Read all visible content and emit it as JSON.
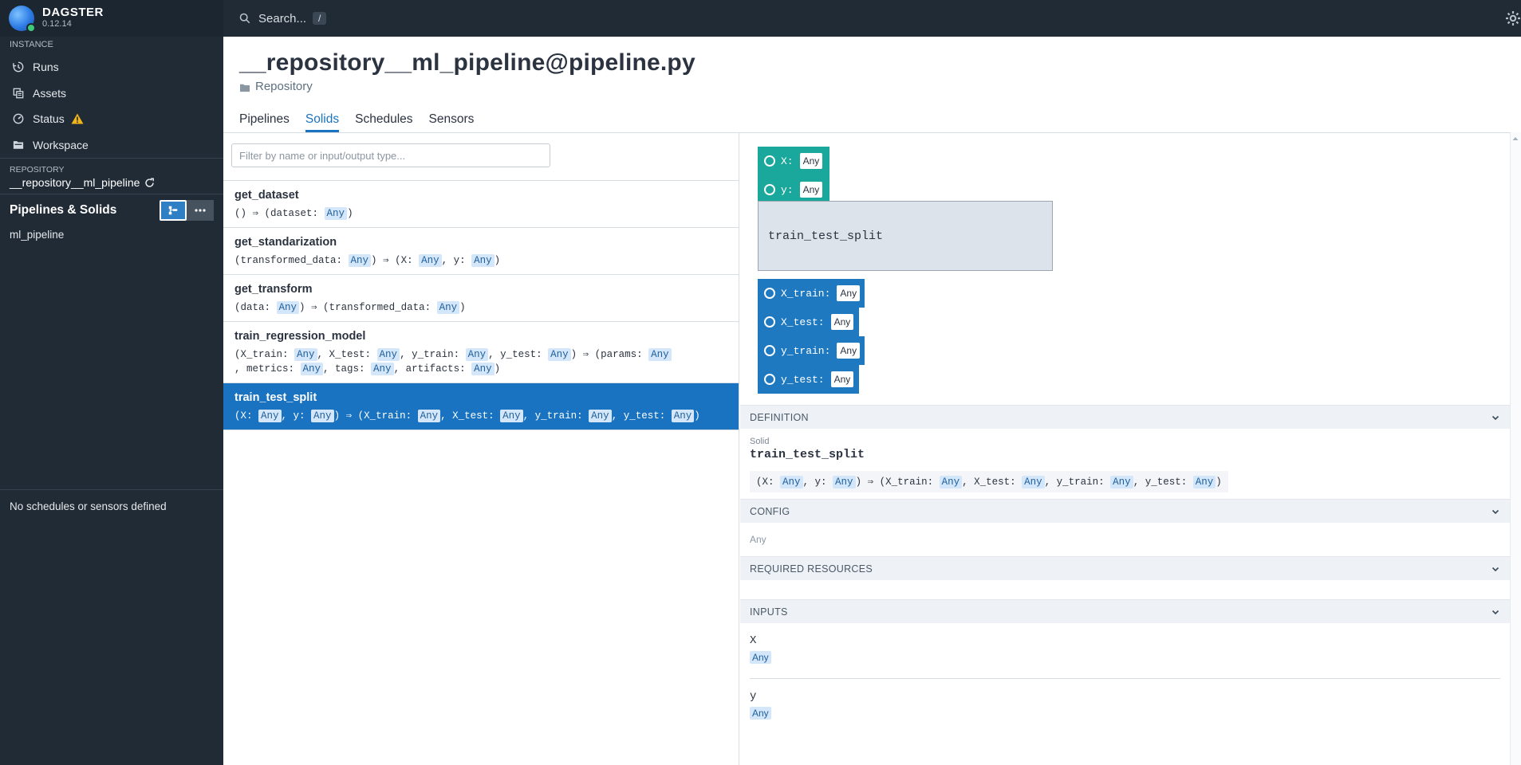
{
  "brand": {
    "name": "DAGSTER",
    "version": "0.12.14"
  },
  "nav": {
    "instance_label": "INSTANCE",
    "items": [
      {
        "label": "Runs",
        "icon": "history-icon"
      },
      {
        "label": "Assets",
        "icon": "assets-icon"
      },
      {
        "label": "Status",
        "icon": "gauge-icon",
        "warning": true
      },
      {
        "label": "Workspace",
        "icon": "folder-icon"
      }
    ],
    "repository_label": "REPOSITORY",
    "repository_name": "__repository__ml_pipeline",
    "pipelines_header": "Pipelines & Solids",
    "pipelines": [
      "ml_pipeline"
    ],
    "schedules_text": "No schedules or sensors defined"
  },
  "topbar": {
    "search_placeholder": "Search...",
    "shortcut": "/"
  },
  "header": {
    "title": "__repository__ml_pipeline@pipeline.py",
    "kind": "Repository",
    "tabs": [
      {
        "label": "Pipelines",
        "active": false
      },
      {
        "label": "Solids",
        "active": true
      },
      {
        "label": "Schedules",
        "active": false
      },
      {
        "label": "Sensors",
        "active": false
      }
    ]
  },
  "solids": {
    "filter_placeholder": "Filter by name or input/output type...",
    "items": [
      {
        "name": "get_dataset",
        "sig": [
          {
            "t": "() ⇒ (dataset: "
          },
          {
            "chip": "Any"
          },
          {
            "t": ")"
          }
        ]
      },
      {
        "name": "get_standarization",
        "sig": [
          {
            "t": "(transformed_data: "
          },
          {
            "chip": "Any"
          },
          {
            "t": ") ⇒ (X: "
          },
          {
            "chip": "Any"
          },
          {
            "t": ", y: "
          },
          {
            "chip": "Any"
          },
          {
            "t": ")"
          }
        ]
      },
      {
        "name": "get_transform",
        "sig": [
          {
            "t": "(data: "
          },
          {
            "chip": "Any"
          },
          {
            "t": ") ⇒ (transformed_data: "
          },
          {
            "chip": "Any"
          },
          {
            "t": ")"
          }
        ]
      },
      {
        "name": "train_regression_model",
        "sig": [
          {
            "t": "(X_train: "
          },
          {
            "chip": "Any"
          },
          {
            "t": ", X_test: "
          },
          {
            "chip": "Any"
          },
          {
            "t": ", y_train: "
          },
          {
            "chip": "Any"
          },
          {
            "t": ", y_test: "
          },
          {
            "chip": "Any"
          },
          {
            "t": ") ⇒ (params: "
          },
          {
            "chip": "Any"
          },
          {
            "t": ", metrics: "
          },
          {
            "chip": "Any"
          },
          {
            "t": ", tags: "
          },
          {
            "chip": "Any"
          },
          {
            "t": ", artifacts: "
          },
          {
            "chip": "Any"
          },
          {
            "t": ")"
          }
        ]
      },
      {
        "name": "train_test_split",
        "selected": true,
        "sig": [
          {
            "t": "(X: "
          },
          {
            "chip": "Any"
          },
          {
            "t": ", y: "
          },
          {
            "chip": "Any"
          },
          {
            "t": ") ⇒ (X_train: "
          },
          {
            "chip": "Any"
          },
          {
            "t": ", X_test: "
          },
          {
            "chip": "Any"
          },
          {
            "t": ", y_train: "
          },
          {
            "chip": "Any"
          },
          {
            "t": ", y_test: "
          },
          {
            "chip": "Any"
          },
          {
            "t": ")"
          }
        ]
      }
    ]
  },
  "graph": {
    "solid_name": "train_test_split",
    "inputs": [
      {
        "name": "X:",
        "type": "Any"
      },
      {
        "name": "y:",
        "type": "Any"
      }
    ],
    "outputs": [
      {
        "name": "X_train:",
        "type": "Any"
      },
      {
        "name": "X_test:",
        "type": "Any"
      },
      {
        "name": "y_train:",
        "type": "Any"
      },
      {
        "name": "y_test:",
        "type": "Any"
      }
    ]
  },
  "detail": {
    "definition_label": "DEFINITION",
    "def_kind": "Solid",
    "def_name": "train_test_split",
    "def_sig": [
      {
        "t": "(X: "
      },
      {
        "chip": "Any"
      },
      {
        "t": ", y: "
      },
      {
        "chip": "Any"
      },
      {
        "t": ") ⇒ (X_train: "
      },
      {
        "chip": "Any"
      },
      {
        "t": ", X_test: "
      },
      {
        "chip": "Any"
      },
      {
        "t": ", y_train: "
      },
      {
        "chip": "Any"
      },
      {
        "t": ", y_test: "
      },
      {
        "chip": "Any"
      },
      {
        "t": ")"
      }
    ],
    "config_label": "CONFIG",
    "config_value": "Any",
    "resources_label": "REQUIRED RESOURCES",
    "inputs_label": "INPUTS",
    "inputs": [
      {
        "name": "X",
        "type": "Any"
      },
      {
        "name": "y",
        "type": "Any"
      }
    ]
  },
  "colors": {
    "nav_bg": "#202b36",
    "accent": "#1a73c0",
    "input_port": "#1aa79c",
    "output_port": "#1f79c0",
    "chip_bg": "#d4e7fa"
  }
}
